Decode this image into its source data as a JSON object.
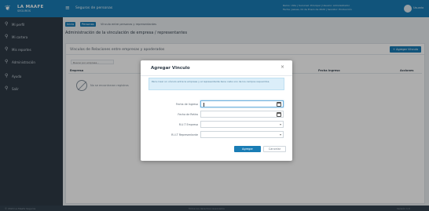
{
  "app": {
    "logo_mark": "❦",
    "name": "LA MAAFE",
    "tagline": "SEGUROS",
    "header_title": "Seguros de personas",
    "user_info_line1": "Ramo: Vida | Sucursal: Principal | Usuario: Administrador",
    "user_info_line2": "Fecha: Jueves, 01 de Enero de 2020 | Servidor: Producción",
    "user_link": "Usuario"
  },
  "sidebar": {
    "items": [
      {
        "icon": "user-icon",
        "glyph": "⚲",
        "label": "Mi perfil"
      },
      {
        "icon": "user-icon",
        "glyph": "⚲",
        "label": "Mi cartera"
      },
      {
        "icon": "user-icon",
        "glyph": "⚲",
        "label": "Mis reportes"
      },
      {
        "icon": "user-icon",
        "glyph": "⚲",
        "label": "Administración"
      },
      {
        "icon": "user-icon",
        "glyph": "⚲",
        "label": "Ayuda"
      },
      {
        "icon": "user-icon",
        "glyph": "⚲",
        "label": "Salir"
      }
    ]
  },
  "breadcrumb": {
    "items": [
      "Inicio",
      "Personas",
      "Vínculo entre personas y representantes"
    ]
  },
  "page": {
    "title": "Administración de la vinculación de empresa / representantes"
  },
  "card": {
    "title": "Vínculos de Relaciones entre empresas y apoderados",
    "add_button": "+ Agregar Vínculo",
    "search_placeholder": "Buscar por empresa...",
    "columns": [
      "Empresa",
      "Representante",
      "Fecha Ingreso",
      "Acciones"
    ],
    "empty_text": "No se encontraron registros"
  },
  "modal": {
    "title": "Agregar Vinculo",
    "close": "×",
    "alert": "Para crear un vínculo entre la empresa y el representante llene cada uno de los campos requeridos.",
    "fields": [
      {
        "label": "Fecha de Ingreso",
        "value": "",
        "kind": "date",
        "focused": true
      },
      {
        "label": "Fecha de Retiro",
        "value": "",
        "kind": "date",
        "focused": false
      },
      {
        "label": "R.U.T Empresa",
        "value": "",
        "kind": "select",
        "focused": false
      },
      {
        "label": "R.U.T Representante",
        "value": "",
        "kind": "select",
        "focused": false
      }
    ],
    "save_label": "Agregar",
    "cancel_label": "Cancelar"
  },
  "footer": {
    "left": "© 2020 La Maafe Seguros",
    "center": "Todos los derechos reservados",
    "right": "Versión 1.0"
  },
  "colors": {
    "brand": "#1a7db5",
    "sidebar": "#2e3a46",
    "overlay": "rgba(0,0,0,.32)"
  }
}
